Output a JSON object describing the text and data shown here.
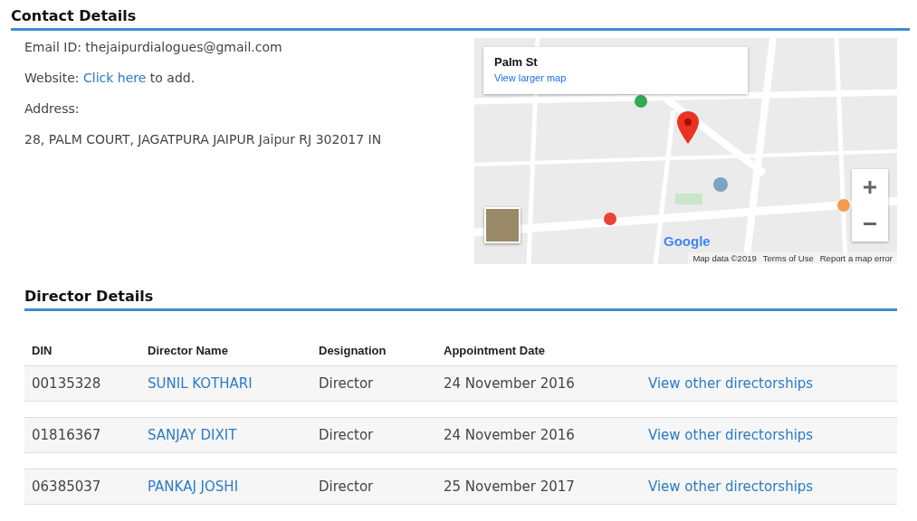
{
  "contact": {
    "title": "Contact Details",
    "email_label": "Email ID:",
    "email": "thejaipurdialogues@gmail.com",
    "website_label": "Website:",
    "website_link": "Click here",
    "website_suffix": "to add.",
    "address_label": "Address:",
    "address": "28, PALM COURT, JAGATPURA JAIPUR Jaipur RJ 302017 IN"
  },
  "map": {
    "place_title": "Palm St",
    "larger_map_link": "View larger map",
    "logo": "Google",
    "attribution": "Map data ©2019",
    "terms_link": "Terms of Use",
    "report_link": "Report a map error"
  },
  "directors": {
    "title": "Director Details",
    "columns": [
      "DIN",
      "Director Name",
      "Designation",
      "Appointment Date"
    ],
    "rows": [
      {
        "din": "00135328",
        "name": "SUNIL KOTHARI",
        "designation": "Director",
        "appointment_date": "24 November 2016",
        "link": "View other directorships"
      },
      {
        "din": "01816367",
        "name": "SANJAY DIXIT",
        "designation": "Director",
        "appointment_date": "24 November 2016",
        "link": "View other directorships"
      },
      {
        "din": "06385037",
        "name": "PANKAJ JOSHI",
        "designation": "Director",
        "appointment_date": "25 November 2017",
        "link": "View other directorships"
      }
    ]
  }
}
